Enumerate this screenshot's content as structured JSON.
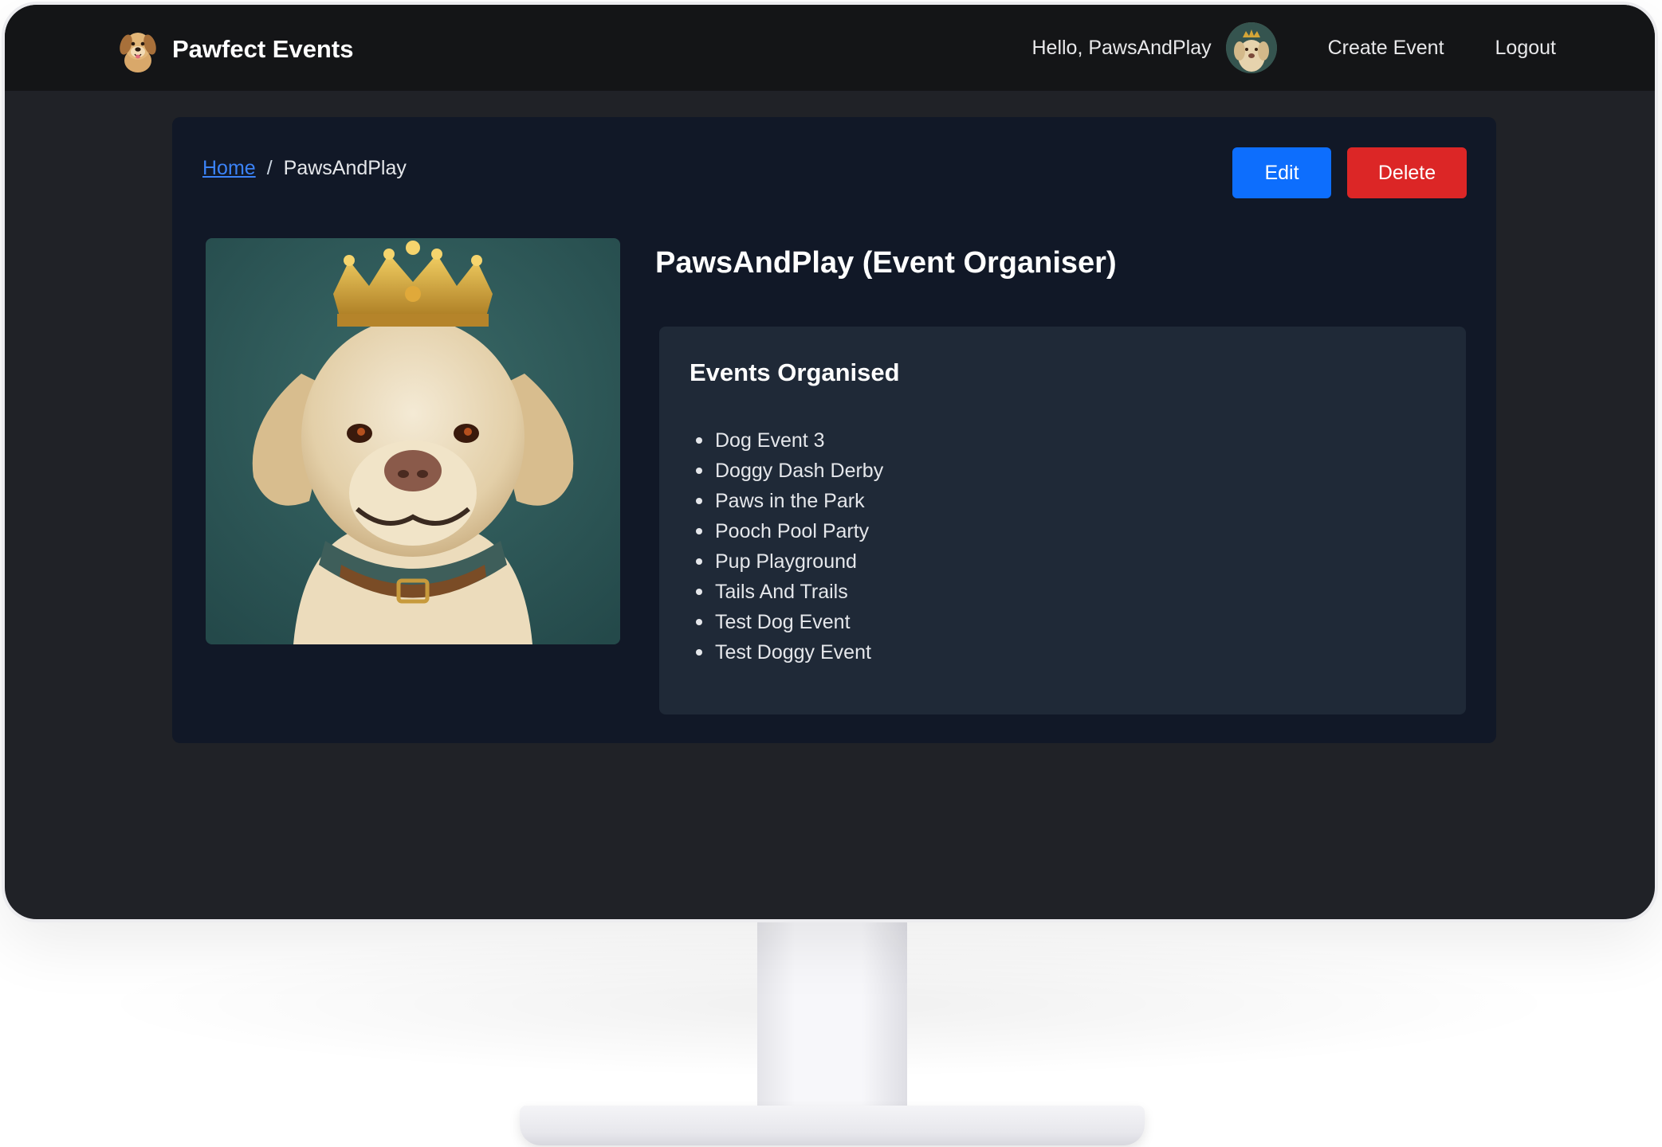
{
  "navbar": {
    "brand": "Pawfect Events",
    "greeting": "Hello, PawsAndPlay",
    "create_event": "Create Event",
    "logout": "Logout"
  },
  "breadcrumb": {
    "home": "Home",
    "separator": "/",
    "current": "PawsAndPlay"
  },
  "actions": {
    "edit": "Edit",
    "delete": "Delete"
  },
  "profile": {
    "title": "PawsAndPlay (Event Organiser)"
  },
  "events": {
    "heading": "Events Organised",
    "items": [
      "Dog Event 3",
      "Doggy Dash Derby",
      "Paws in the Park",
      "Pooch Pool Party",
      "Pup Playground",
      "Tails And Trails",
      "Test Dog Event",
      "Test Doggy Event"
    ]
  },
  "colors": {
    "navbar_bg": "#141517",
    "page_bg": "#202227",
    "card_bg": "#111827",
    "panel_bg": "#1f2937",
    "edit_button": "#0d6efd",
    "delete_button": "#dc2626",
    "link": "#3b82f6"
  }
}
